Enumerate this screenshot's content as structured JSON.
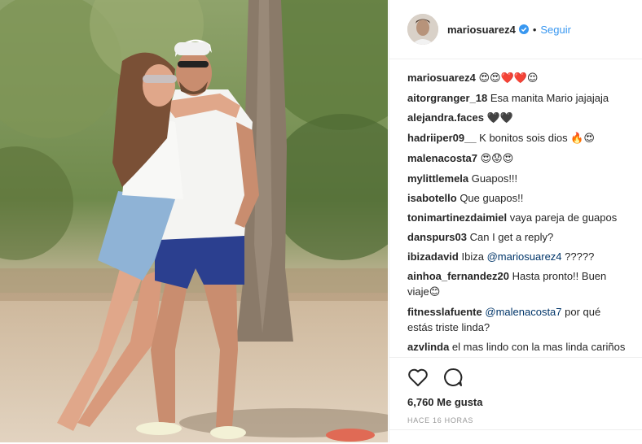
{
  "post": {
    "username": "mariosuarez4",
    "separator": "•",
    "follow_label": "Seguir",
    "likes": "6,760 Me gusta",
    "timestamp": "HACE 16 HORAS"
  },
  "comments": [
    {
      "user": "mariosuarez4",
      "text": "",
      "emoji": "😍😍❤️❤️😌"
    },
    {
      "user": "aitorgranger_18",
      "text": "Esa manita Mario jajajaja"
    },
    {
      "user": "alejandra.faces",
      "text": "",
      "emoji": "🖤🖤"
    },
    {
      "user": "hadriiper09__",
      "text": "K bonitos sois dios",
      "emoji": "🔥😍"
    },
    {
      "user": "malenacosta7",
      "text": "",
      "emoji": "😍😟😍"
    },
    {
      "user": "mylittlemela",
      "text": "Guapos!!!"
    },
    {
      "user": "isabotello",
      "text": "Que guapos!!"
    },
    {
      "user": "tonimartinezdaimiel",
      "text": "vaya pareja de guapos"
    },
    {
      "user": "danspurs03",
      "text": "Can I get a reply?"
    },
    {
      "user": "ibizadavid",
      "text": "Ibiza",
      "mention": "@mariosuarez4",
      "after": "?????"
    },
    {
      "user": "ainhoa_fernandez20",
      "text": "Hasta pronto!! Buen viaje",
      "emoji": "😊"
    },
    {
      "user": "fitnesslafuente",
      "mention": "@malenacosta7",
      "text": "por qué estás triste linda?"
    },
    {
      "user": "azvlinda",
      "text": "el mas lindo con la mas linda cariños"
    }
  ],
  "colors": {
    "link": "#3897f0",
    "mention": "#003569",
    "muted": "#999999",
    "border": "#efefef"
  }
}
